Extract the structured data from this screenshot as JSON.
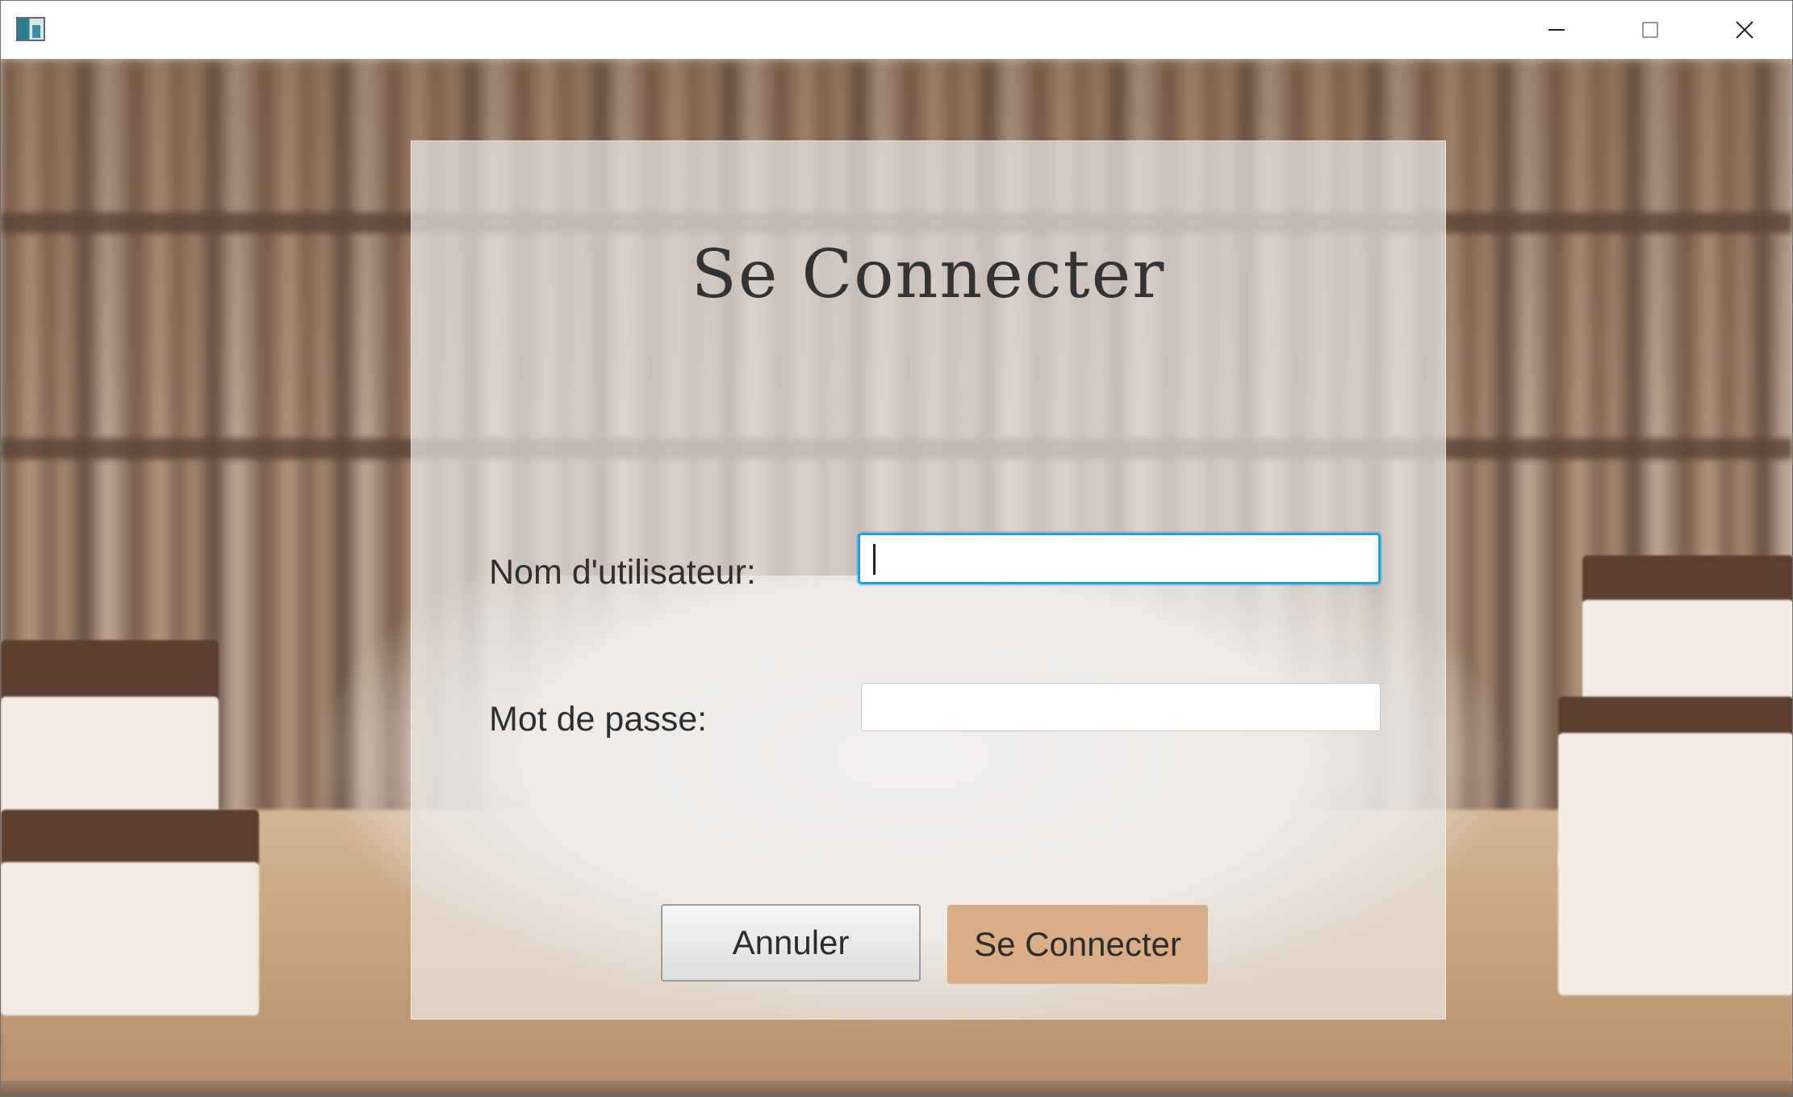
{
  "window": {
    "controls": {
      "minimize": "minimize-icon",
      "maximize": "maximize-icon",
      "close": "close-icon"
    }
  },
  "login": {
    "title": "Se Connecter",
    "username_label": "Nom d'utilisateur:",
    "username_value": "",
    "password_label": "Mot de passe:",
    "password_value": "",
    "cancel_label": "Annuler",
    "submit_label": "Se Connecter"
  },
  "colors": {
    "focus_border": "#1ba1e2",
    "submit_button": "#d9ae86",
    "panel_overlay": "#eceae8"
  }
}
